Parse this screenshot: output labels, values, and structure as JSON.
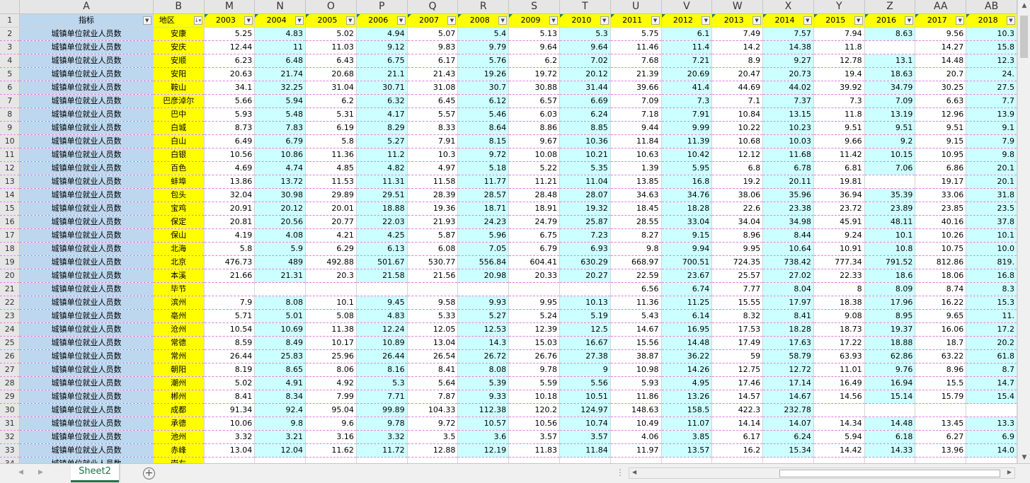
{
  "column_letters": [
    "A",
    "B",
    "M",
    "N",
    "O",
    "P",
    "Q",
    "R",
    "S",
    "T",
    "U",
    "V",
    "W",
    "X",
    "Y",
    "Z",
    "AA",
    "AB"
  ],
  "header": {
    "indicator": "指标",
    "region": "地区",
    "years": [
      "2003",
      "2004",
      "2005",
      "2006",
      "2007",
      "2008",
      "2009",
      "2010",
      "2011",
      "2012",
      "2013",
      "2014",
      "2015",
      "2016",
      "2017",
      "2018"
    ]
  },
  "row_numbers": [
    "1",
    "2",
    "3",
    "4",
    "5",
    "6",
    "7",
    "8",
    "9",
    "10",
    "11",
    "12",
    "13",
    "14",
    "15",
    "16",
    "17",
    "18",
    "19",
    "20",
    "21",
    "22",
    "23",
    "24",
    "25",
    "26",
    "27",
    "28",
    "29",
    "30",
    "31",
    "32",
    "33",
    "34"
  ],
  "rows": [
    {
      "ind": "城镇单位就业人员数",
      "region": "安康",
      "v": [
        "5.25",
        "4.83",
        "5.02",
        "4.94",
        "5.07",
        "5.4",
        "5.13",
        "5.3",
        "5.75",
        "6.1",
        "7.49",
        "7.57",
        "7.94",
        "8.63",
        "9.56",
        "10.3"
      ]
    },
    {
      "ind": "城镇单位就业人员数",
      "region": "安庆",
      "v": [
        "12.44",
        "11",
        "11.03",
        "9.12",
        "9.83",
        "9.79",
        "9.64",
        "9.64",
        "11.46",
        "11.4",
        "14.2",
        "14.38",
        "11.8",
        "",
        "14.27",
        "15.8"
      ]
    },
    {
      "ind": "城镇单位就业人员数",
      "region": "安顺",
      "v": [
        "6.23",
        "6.48",
        "6.43",
        "6.75",
        "6.17",
        "5.76",
        "6.2",
        "7.02",
        "7.68",
        "7.21",
        "8.9",
        "9.27",
        "12.78",
        "13.1",
        "14.48",
        "12.3"
      ]
    },
    {
      "ind": "城镇单位就业人员数",
      "region": "安阳",
      "v": [
        "20.63",
        "21.74",
        "20.68",
        "21.1",
        "21.43",
        "19.26",
        "19.72",
        "20.12",
        "21.39",
        "20.69",
        "20.47",
        "20.73",
        "19.4",
        "18.63",
        "20.7",
        "24."
      ]
    },
    {
      "ind": "城镇单位就业人员数",
      "region": "鞍山",
      "v": [
        "34.1",
        "32.25",
        "31.04",
        "30.71",
        "31.08",
        "30.7",
        "30.88",
        "31.44",
        "39.66",
        "41.4",
        "44.69",
        "44.02",
        "39.92",
        "34.79",
        "30.25",
        "27.5"
      ]
    },
    {
      "ind": "城镇单位就业人员数",
      "region": "巴彦淖尔",
      "v": [
        "5.66",
        "5.94",
        "6.2",
        "6.32",
        "6.45",
        "6.12",
        "6.57",
        "6.69",
        "7.09",
        "7.3",
        "7.1",
        "7.37",
        "7.3",
        "7.09",
        "6.63",
        "7.7"
      ]
    },
    {
      "ind": "城镇单位就业人员数",
      "region": "巴中",
      "v": [
        "5.93",
        "5.48",
        "5.31",
        "4.17",
        "5.57",
        "5.46",
        "6.03",
        "6.24",
        "7.18",
        "7.91",
        "10.84",
        "13.15",
        "11.8",
        "13.19",
        "12.96",
        "13.9"
      ]
    },
    {
      "ind": "城镇单位就业人员数",
      "region": "白城",
      "v": [
        "8.73",
        "7.83",
        "6.19",
        "8.29",
        "8.33",
        "8.64",
        "8.86",
        "8.85",
        "9.44",
        "9.99",
        "10.22",
        "10.23",
        "9.51",
        "9.51",
        "9.51",
        "9.1"
      ]
    },
    {
      "ind": "城镇单位就业人员数",
      "region": "白山",
      "v": [
        "6.49",
        "6.79",
        "5.8",
        "5.27",
        "7.91",
        "8.15",
        "9.67",
        "10.36",
        "11.84",
        "11.39",
        "10.68",
        "10.03",
        "9.66",
        "9.2",
        "9.15",
        "7.9"
      ]
    },
    {
      "ind": "城镇单位就业人员数",
      "region": "白银",
      "v": [
        "10.56",
        "10.86",
        "11.36",
        "11.2",
        "10.3",
        "9.72",
        "10.08",
        "10.21",
        "10.63",
        "10.42",
        "12.12",
        "11.68",
        "11.42",
        "10.15",
        "10.95",
        "9.8"
      ]
    },
    {
      "ind": "城镇单位就业人员数",
      "region": "百色",
      "v": [
        "4.69",
        "4.74",
        "4.85",
        "4.82",
        "4.97",
        "5.18",
        "5.22",
        "5.35",
        "1.39",
        "5.95",
        "6.8",
        "6.78",
        "6.81",
        "7.06",
        "6.86",
        "20.1"
      ]
    },
    {
      "ind": "城镇单位就业人员数",
      "region": "蚌埠",
      "v": [
        "13.86",
        "13.72",
        "11.53",
        "11.31",
        "11.58",
        "11.77",
        "11.21",
        "11.04",
        "13.85",
        "16.8",
        "19.2",
        "20.11",
        "19.81",
        "",
        "19.17",
        "20.1"
      ]
    },
    {
      "ind": "城镇单位就业人员数",
      "region": "包头",
      "v": [
        "32.04",
        "30.98",
        "29.89",
        "29.51",
        "28.39",
        "28.57",
        "28.48",
        "28.07",
        "34.63",
        "34.76",
        "38.06",
        "35.96",
        "36.94",
        "35.39",
        "33.06",
        "31.8"
      ]
    },
    {
      "ind": "城镇单位就业人员数",
      "region": "宝鸡",
      "v": [
        "20.91",
        "20.12",
        "20.01",
        "18.88",
        "19.36",
        "18.71",
        "18.91",
        "19.32",
        "18.45",
        "18.28",
        "22.6",
        "23.38",
        "23.72",
        "23.89",
        "23.85",
        "23.5"
      ]
    },
    {
      "ind": "城镇单位就业人员数",
      "region": "保定",
      "v": [
        "20.81",
        "20.56",
        "20.77",
        "22.03",
        "21.93",
        "24.23",
        "24.79",
        "25.87",
        "28.55",
        "33.04",
        "34.04",
        "34.98",
        "45.91",
        "48.11",
        "40.16",
        "37.8"
      ]
    },
    {
      "ind": "城镇单位就业人员数",
      "region": "保山",
      "v": [
        "4.19",
        "4.08",
        "4.21",
        "4.25",
        "5.87",
        "5.96",
        "6.75",
        "7.23",
        "8.27",
        "9.15",
        "8.96",
        "8.44",
        "9.24",
        "10.1",
        "10.26",
        "10.1"
      ]
    },
    {
      "ind": "城镇单位就业人员数",
      "region": "北海",
      "v": [
        "5.8",
        "5.9",
        "6.29",
        "6.13",
        "6.08",
        "7.05",
        "6.79",
        "6.93",
        "9.8",
        "9.94",
        "9.95",
        "10.64",
        "10.91",
        "10.8",
        "10.75",
        "10.0"
      ]
    },
    {
      "ind": "城镇单位就业人员数",
      "region": "北京",
      "v": [
        "476.73",
        "489",
        "492.88",
        "501.67",
        "530.77",
        "556.84",
        "604.41",
        "630.29",
        "668.97",
        "700.51",
        "724.35",
        "738.42",
        "777.34",
        "791.52",
        "812.86",
        "819."
      ]
    },
    {
      "ind": "城镇单位就业人员数",
      "region": "本溪",
      "v": [
        "21.66",
        "21.31",
        "20.3",
        "21.58",
        "21.56",
        "20.98",
        "20.33",
        "20.27",
        "22.59",
        "23.67",
        "25.57",
        "27.02",
        "22.33",
        "18.6",
        "18.06",
        "16.8"
      ]
    },
    {
      "ind": "城镇单位就业人员数",
      "region": "毕节",
      "v": [
        "",
        "",
        "",
        "",
        "",
        "",
        "",
        "",
        "6.56",
        "6.74",
        "7.77",
        "8.04",
        "8",
        "8.09",
        "8.74",
        "8.3"
      ]
    },
    {
      "ind": "城镇单位就业人员数",
      "region": "滨州",
      "v": [
        "7.9",
        "8.08",
        "10.1",
        "9.45",
        "9.58",
        "9.93",
        "9.95",
        "10.13",
        "11.36",
        "11.25",
        "15.55",
        "17.97",
        "18.38",
        "17.96",
        "16.22",
        "15.3"
      ]
    },
    {
      "ind": "城镇单位就业人员数",
      "region": "亳州",
      "v": [
        "5.71",
        "5.01",
        "5.08",
        "4.83",
        "5.33",
        "5.27",
        "5.24",
        "5.19",
        "5.43",
        "6.14",
        "8.32",
        "8.41",
        "9.08",
        "8.95",
        "9.65",
        "11."
      ]
    },
    {
      "ind": "城镇单位就业人员数",
      "region": "沧州",
      "v": [
        "10.54",
        "10.69",
        "11.38",
        "12.24",
        "12.05",
        "12.53",
        "12.39",
        "12.5",
        "14.67",
        "16.95",
        "17.53",
        "18.28",
        "18.73",
        "19.37",
        "16.06",
        "17.2"
      ]
    },
    {
      "ind": "城镇单位就业人员数",
      "region": "常德",
      "v": [
        "8.59",
        "8.49",
        "10.17",
        "10.89",
        "13.04",
        "14.3",
        "15.03",
        "16.67",
        "15.56",
        "14.48",
        "17.49",
        "17.63",
        "17.22",
        "18.88",
        "18.7",
        "20.2"
      ]
    },
    {
      "ind": "城镇单位就业人员数",
      "region": "常州",
      "v": [
        "26.44",
        "25.83",
        "25.96",
        "26.44",
        "26.54",
        "26.72",
        "26.76",
        "27.38",
        "38.87",
        "36.22",
        "59",
        "58.79",
        "63.93",
        "62.86",
        "63.22",
        "61.8"
      ]
    },
    {
      "ind": "城镇单位就业人员数",
      "region": "朝阳",
      "v": [
        "8.19",
        "8.65",
        "8.06",
        "8.16",
        "8.41",
        "8.08",
        "9.78",
        "9",
        "10.98",
        "14.26",
        "12.75",
        "12.72",
        "11.01",
        "9.76",
        "8.96",
        "8.7"
      ]
    },
    {
      "ind": "城镇单位就业人员数",
      "region": "潮州",
      "v": [
        "5.02",
        "4.91",
        "4.92",
        "5.3",
        "5.64",
        "5.39",
        "5.59",
        "5.56",
        "5.93",
        "4.95",
        "17.46",
        "17.14",
        "16.49",
        "16.94",
        "15.5",
        "14.7"
      ]
    },
    {
      "ind": "城镇单位就业人员数",
      "region": "郴州",
      "v": [
        "8.41",
        "8.34",
        "7.99",
        "7.71",
        "7.87",
        "9.33",
        "10.18",
        "10.51",
        "11.86",
        "13.26",
        "14.57",
        "14.67",
        "14.56",
        "15.14",
        "15.79",
        "15.4"
      ]
    },
    {
      "ind": "城镇单位就业人员数",
      "region": "成都",
      "v": [
        "91.34",
        "92.4",
        "95.04",
        "99.89",
        "104.33",
        "112.38",
        "120.2",
        "124.97",
        "148.63",
        "158.5",
        "422.3",
        "232.78",
        "",
        "",
        "",
        ""
      ]
    },
    {
      "ind": "城镇单位就业人员数",
      "region": "承德",
      "v": [
        "10.06",
        "9.8",
        "9.6",
        "9.78",
        "9.72",
        "10.57",
        "10.56",
        "10.74",
        "10.49",
        "11.07",
        "14.14",
        "14.07",
        "14.34",
        "14.48",
        "13.45",
        "13.3"
      ]
    },
    {
      "ind": "城镇单位就业人员数",
      "region": "池州",
      "v": [
        "3.32",
        "3.21",
        "3.16",
        "3.32",
        "3.5",
        "3.6",
        "3.57",
        "3.57",
        "4.06",
        "3.85",
        "6.17",
        "6.24",
        "5.94",
        "6.18",
        "6.27",
        "6.9"
      ]
    },
    {
      "ind": "城镇单位就业人员数",
      "region": "赤峰",
      "v": [
        "13.04",
        "12.04",
        "11.62",
        "11.72",
        "12.88",
        "12.19",
        "11.83",
        "11.84",
        "11.97",
        "13.57",
        "16.2",
        "15.34",
        "14.42",
        "14.33",
        "13.96",
        "14.0"
      ]
    },
    {
      "ind": "城镇单位就业人员数",
      "region": "崇左",
      "v": [
        "",
        "",
        "",
        "",
        "",
        "",
        "",
        "",
        "",
        "",
        "",
        "",
        "",
        "",
        "",
        ""
      ]
    }
  ],
  "sheet_tab": "Sheet2",
  "colors": {
    "indicator_fill": "#bdd7ee",
    "region_fill": "#ffff00",
    "year_fill": "#ffff00",
    "alt_column_fill": "#ccffff",
    "active_tab": "#217346"
  },
  "icons": {
    "filter": "filter-dropdown-icon",
    "sort_filter": "sort-filter-icon",
    "add_sheet": "plus-circle-icon"
  }
}
